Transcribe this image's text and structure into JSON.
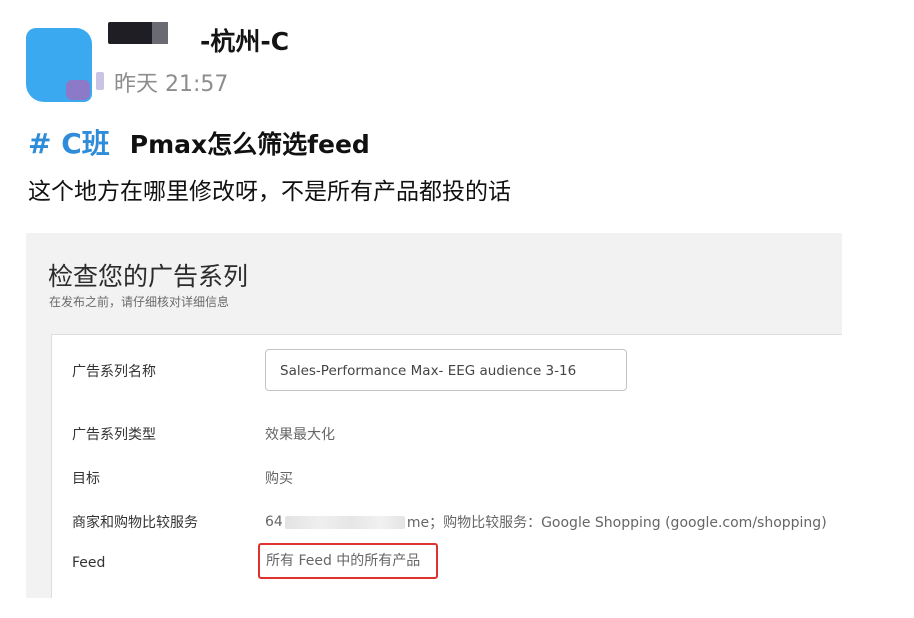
{
  "post": {
    "author_suffix": "-杭州-C",
    "timestamp": "昨天 21:57",
    "hashtag": "# C班",
    "title": "Pmax怎么筛选feed",
    "body": "这个地方在哪里修改呀，不是所有产品都投的话"
  },
  "colors": {
    "avatar": "#3aa9f0",
    "hashtag": "#2f8cd8",
    "highlight_border": "#e0322f"
  },
  "screenshot": {
    "title": "检查您的广告系列",
    "subtitle": "在发布之前，请仔细核对详细信息",
    "rows": {
      "campaign_name": {
        "label": "广告系列名称",
        "value": "Sales-Performance Max- EEG audience 3-16"
      },
      "campaign_type": {
        "label": "广告系列类型",
        "value": "效果最大化"
      },
      "goal": {
        "label": "目标",
        "value": "购买"
      },
      "merchant": {
        "label": "商家和购物比较服务",
        "value_prefix": "64",
        "value_suffix": "me；购物比较服务：Google Shopping (google.com/shopping)"
      },
      "feed": {
        "label": "Feed",
        "value": "所有 Feed 中的所有产品"
      }
    }
  }
}
